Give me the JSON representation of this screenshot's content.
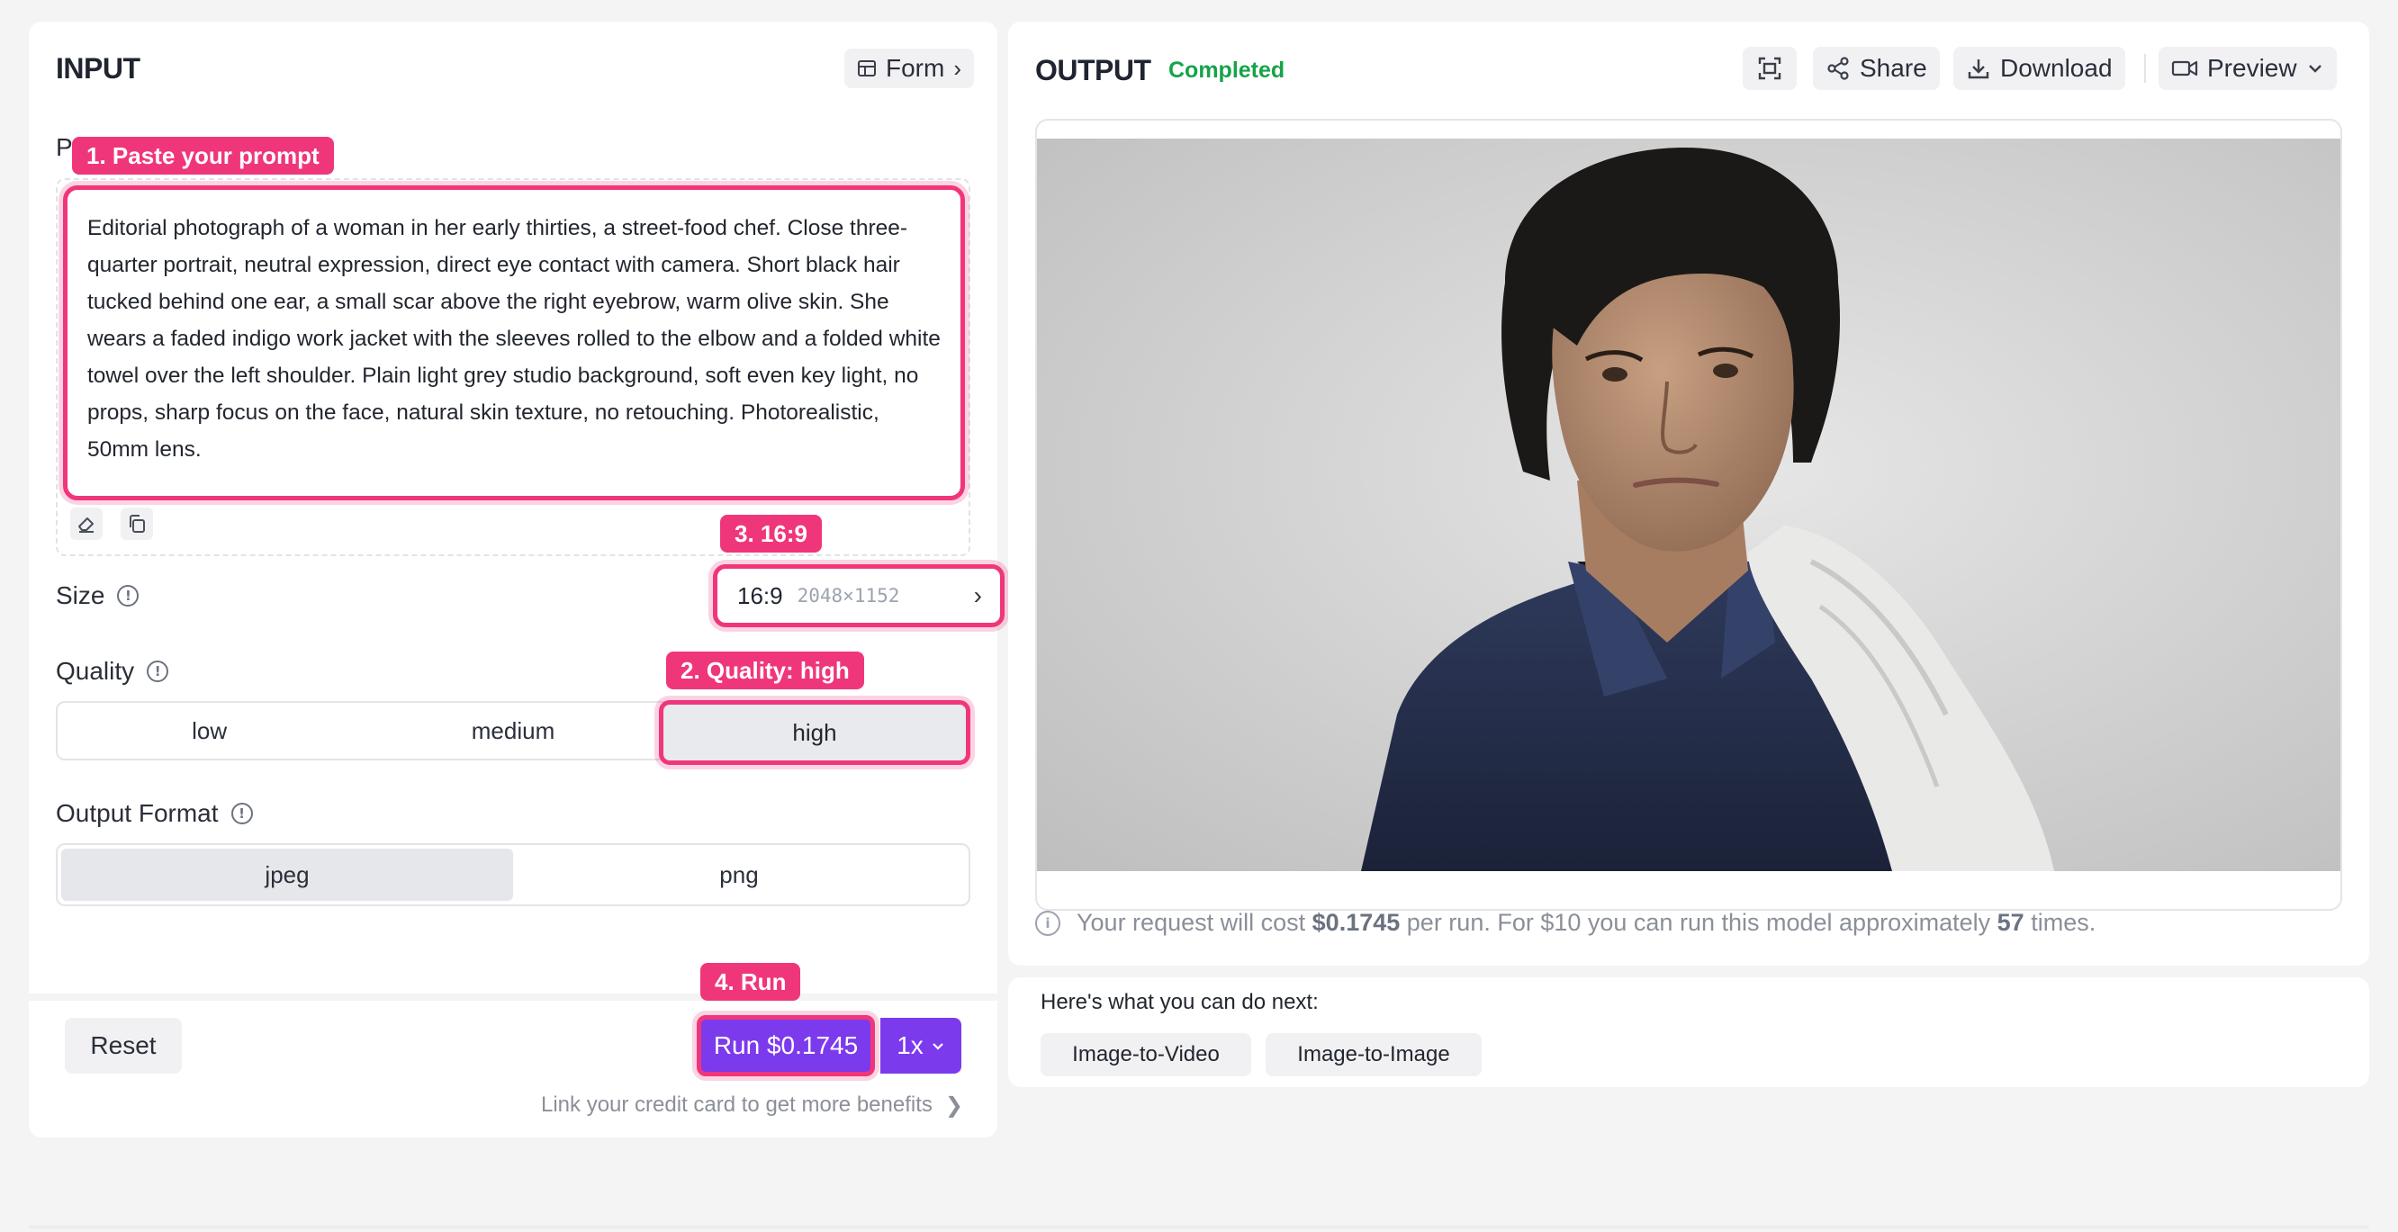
{
  "input": {
    "title": "INPUT",
    "form_toggle": "Form",
    "form_chevron": "›",
    "prompt_label_visible": "P",
    "prompt_text": "Editorial photograph of a woman in her early thirties, a street-food chef. Close three-quarter portrait, neutral expression, direct eye contact with camera. Short black hair tucked behind one ear, a small scar above the right eyebrow, warm olive skin. She wears a faded indigo work jacket with the sleeves rolled to the elbow and a folded white towel over the left shoulder. Plain light grey studio background, soft even key light, no props, sharp focus on the face, natural skin texture, no retouching. Photorealistic, 50mm lens.",
    "size": {
      "label": "Size",
      "ratio": "16:9",
      "dims": "2048×1152",
      "chevron": "›"
    },
    "quality": {
      "label": "Quality",
      "options": [
        "low",
        "medium",
        "high"
      ],
      "selected": "high"
    },
    "output_format": {
      "label": "Output Format",
      "options": [
        "jpeg",
        "png"
      ],
      "selected": "jpeg"
    },
    "reset_label": "Reset",
    "run_label": "Run $0.1745",
    "multiplier": "1x",
    "credit_link": "Link your credit card to get more benefits",
    "credit_chevron": "❯"
  },
  "badges": {
    "step1": "1. Paste your prompt",
    "step2": "2. Quality: high",
    "step3": "3. 16:9",
    "step4": "4. Run"
  },
  "output": {
    "title": "OUTPUT",
    "status": "Completed",
    "status_color": "#16a34a",
    "share_label": "Share",
    "download_label": "Download",
    "preview_label": "Preview",
    "cost": {
      "prefix": "Your request will cost",
      "amount": "$0.1745",
      "middle": "per run. For $10 you can run this model approximately",
      "count": "57",
      "suffix": "times."
    }
  },
  "next": {
    "heading": "Here's what you can do next:",
    "chips": [
      "Image-to-Video",
      "Image-to-Image"
    ]
  },
  "colors": {
    "accent": "#7c3aed",
    "highlight": "#f0367a",
    "success": "#16a34a"
  },
  "icons": {
    "form": "table-icon",
    "eraser": "eraser-icon",
    "copy": "copy-icon",
    "info": "info-icon",
    "fullscreen": "fullscreen-icon",
    "share": "share-icon",
    "download": "download-icon",
    "preview": "video-camera-icon",
    "dropdown": "chevron-down-icon"
  }
}
